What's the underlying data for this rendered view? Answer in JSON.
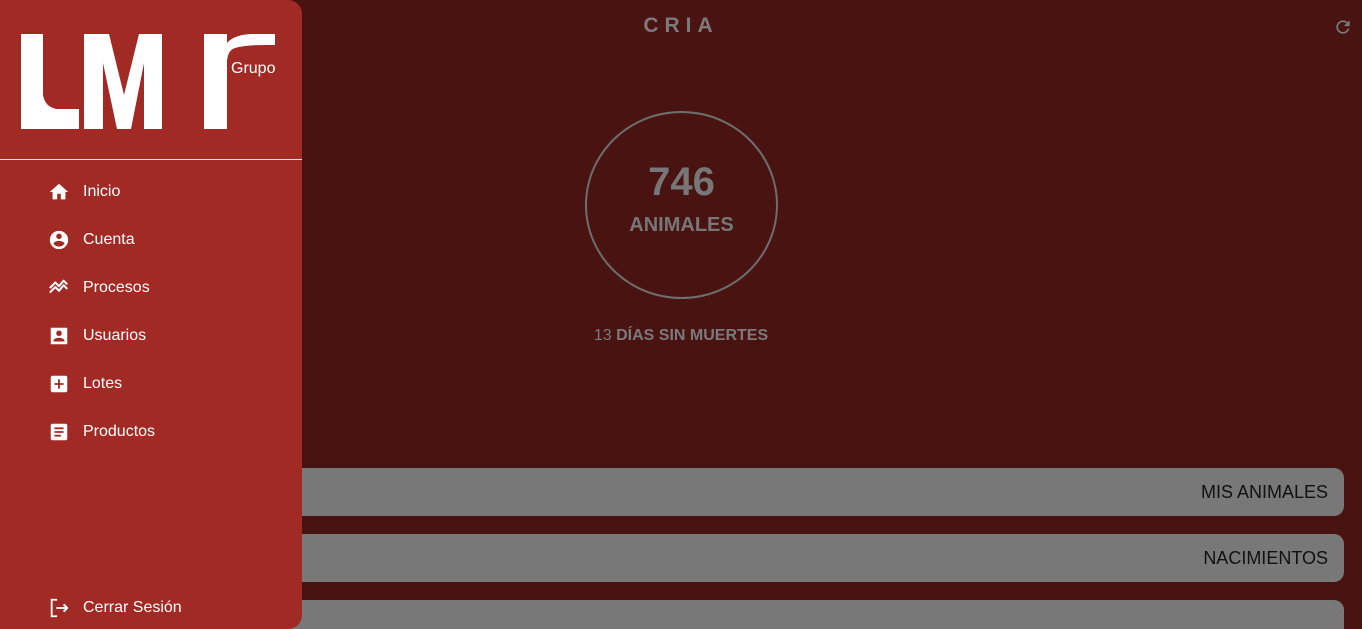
{
  "header": {
    "title": "CRIA",
    "refresh_icon": "refresh-icon"
  },
  "summary": {
    "count": "746",
    "count_label": "ANIMALES",
    "days_number": "13",
    "days_text": "DÍAS SIN MUERTES"
  },
  "menu": {
    "items": [
      {
        "label": "MIS ANIMALES"
      },
      {
        "label": "NACIMIENTOS"
      },
      {
        "label": ""
      }
    ]
  },
  "drawer": {
    "logo": {
      "main": "LMI",
      "sub": "Grupo"
    },
    "items": [
      {
        "label": "Inicio",
        "icon": "home-icon"
      },
      {
        "label": "Cuenta",
        "icon": "account-circle-icon"
      },
      {
        "label": "Procesos",
        "icon": "trending-icon"
      },
      {
        "label": "Usuarios",
        "icon": "contact-card-icon"
      },
      {
        "label": "Lotes",
        "icon": "add-box-icon"
      },
      {
        "label": "Productos",
        "icon": "document-icon"
      }
    ],
    "logout": {
      "label": "Cerrar Sesión",
      "icon": "logout-icon"
    }
  },
  "colors": {
    "drawer": "#a22a24",
    "backdrop": "#491311",
    "bar": "#787878"
  }
}
